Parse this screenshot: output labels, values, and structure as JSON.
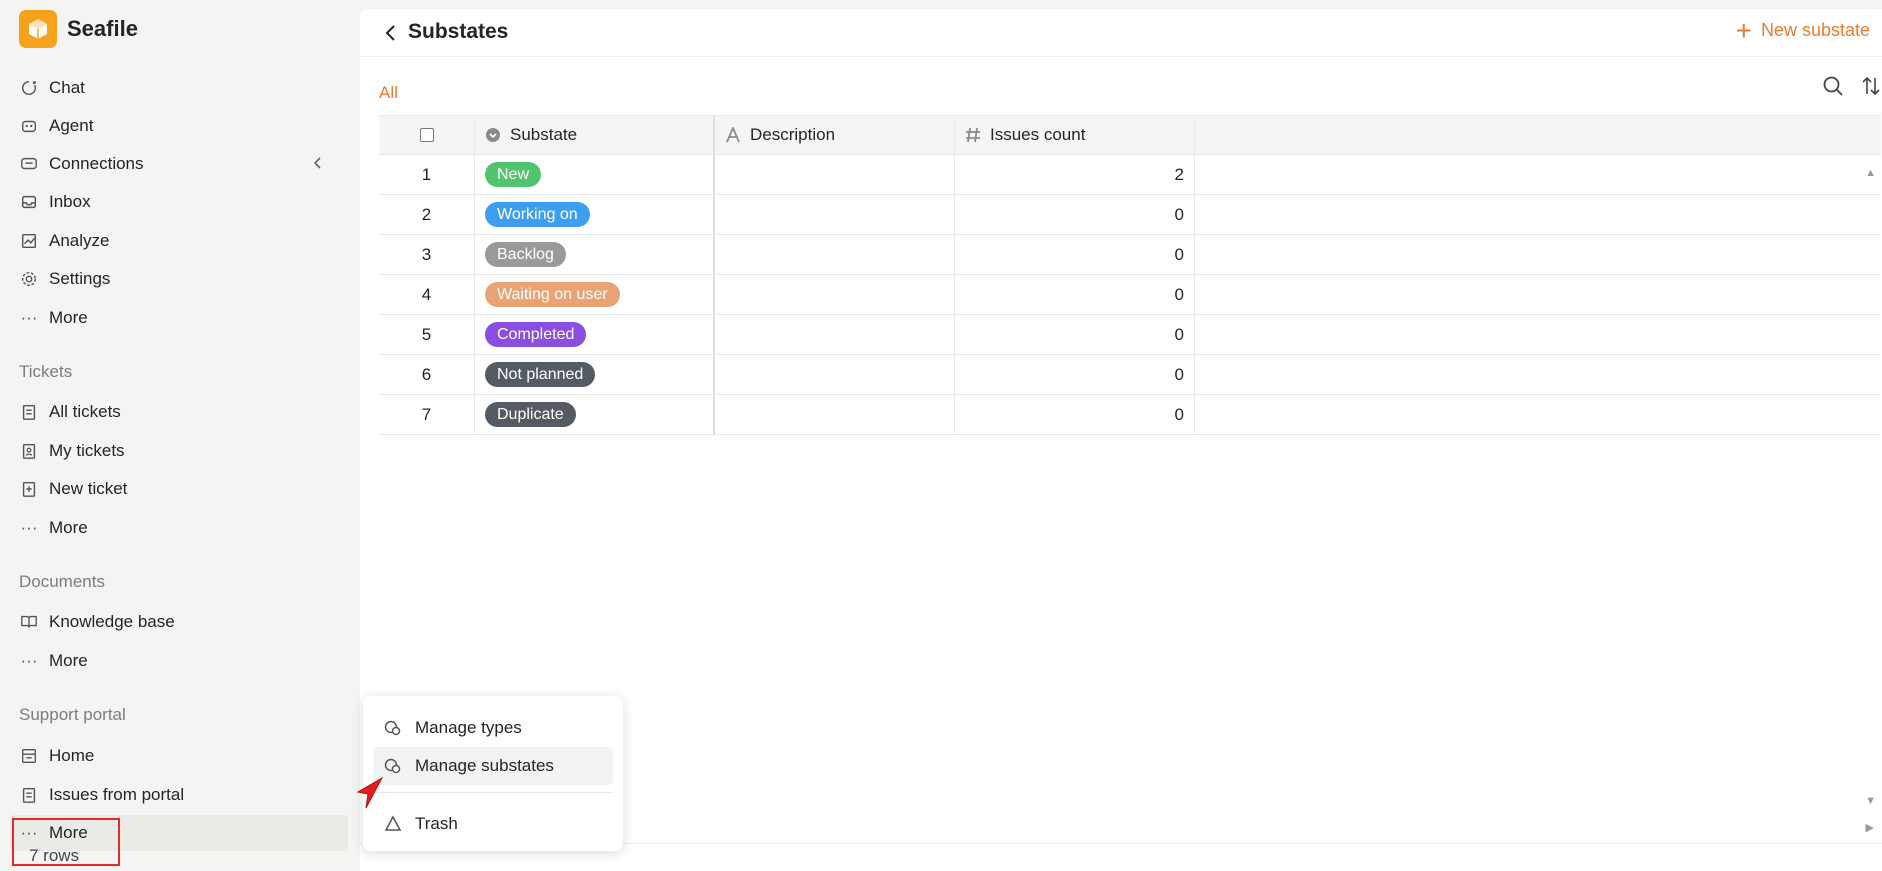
{
  "app": {
    "name": "Seafile"
  },
  "sidebar": {
    "main_items": [
      {
        "label": "Chat",
        "icon": "chat-icon"
      },
      {
        "label": "Agent",
        "icon": "robot-icon"
      },
      {
        "label": "Connections",
        "icon": "connections-icon"
      },
      {
        "label": "Inbox",
        "icon": "inbox-icon"
      },
      {
        "label": "Analyze",
        "icon": "chart-icon"
      },
      {
        "label": "Settings",
        "icon": "gear-icon"
      },
      {
        "label": "More",
        "icon": "more-icon"
      }
    ],
    "tickets": {
      "title": "Tickets",
      "items": [
        {
          "label": "All tickets"
        },
        {
          "label": "My tickets"
        },
        {
          "label": "New ticket"
        },
        {
          "label": "More"
        }
      ]
    },
    "documents": {
      "title": "Documents",
      "items": [
        {
          "label": "Knowledge base"
        },
        {
          "label": "More"
        }
      ]
    },
    "support_portal": {
      "title": "Support portal",
      "items": [
        {
          "label": "Home"
        },
        {
          "label": "Issues from portal"
        },
        {
          "label": "More"
        }
      ]
    }
  },
  "header": {
    "title": "Substates",
    "new_button": "New substate"
  },
  "tabs": [
    {
      "label": "All"
    }
  ],
  "table": {
    "columns": [
      "Substate",
      "Description",
      "Issues count"
    ],
    "rows": [
      {
        "num": "1",
        "substate": "New",
        "color": "#51c46e",
        "description": "",
        "count": "2"
      },
      {
        "num": "2",
        "substate": "Working on",
        "color": "#3e9ff0",
        "description": "",
        "count": "0"
      },
      {
        "num": "3",
        "substate": "Backlog",
        "color": "#9a9a9a",
        "description": "",
        "count": "0"
      },
      {
        "num": "4",
        "substate": "Waiting on user",
        "color": "#eaa374",
        "description": "",
        "count": "0"
      },
      {
        "num": "5",
        "substate": "Completed",
        "color": "#8a4fe0",
        "description": "",
        "count": "0"
      },
      {
        "num": "6",
        "substate": "Not planned",
        "color": "#545b63",
        "description": "",
        "count": "0"
      },
      {
        "num": "7",
        "substate": "Duplicate",
        "color": "#545b63",
        "description": "",
        "count": "0"
      }
    ],
    "footer": "7 rows"
  },
  "popup_menu": {
    "items": [
      {
        "label": "Manage types"
      },
      {
        "label": "Manage substates"
      },
      {
        "label": "Trash"
      }
    ]
  },
  "colors": {
    "accent": "#ec7a2f",
    "brand": "#f6a21d"
  }
}
